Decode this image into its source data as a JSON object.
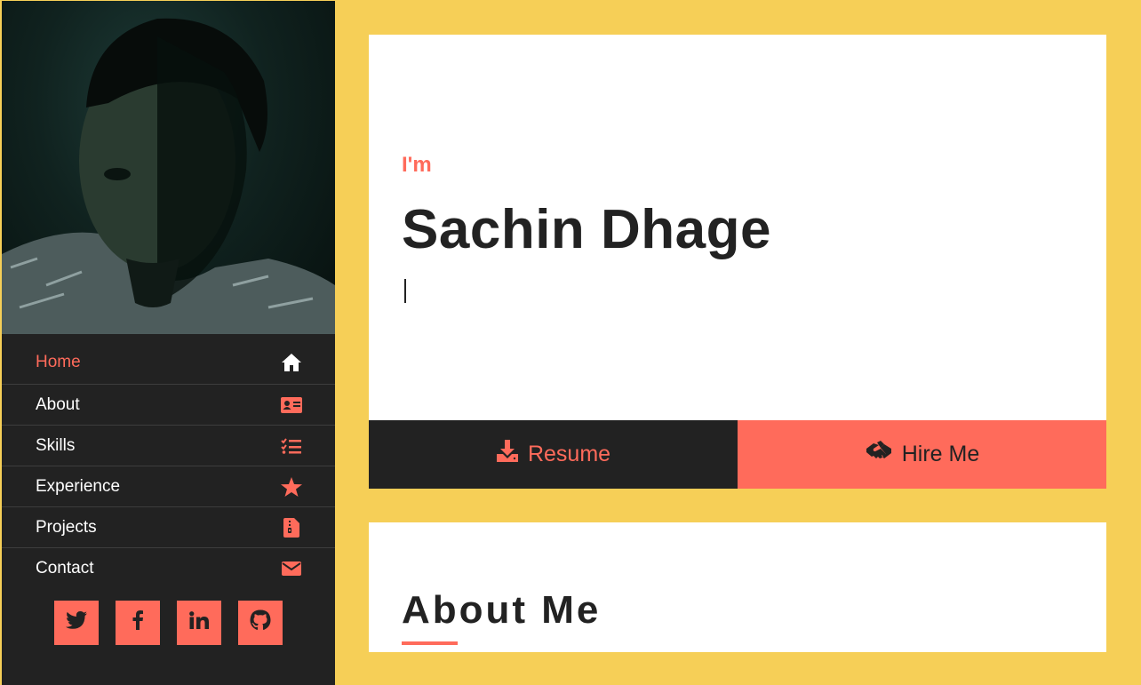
{
  "colors": {
    "accent": "#ff6b5b",
    "dark": "#222222",
    "background": "#f6cf57",
    "card": "#ffffff"
  },
  "sidebar": {
    "photo_icon": "portrait-photo",
    "nav": [
      {
        "label": "Home",
        "icon": "home-icon",
        "active": true
      },
      {
        "label": "About",
        "icon": "id-card-icon",
        "active": false
      },
      {
        "label": "Skills",
        "icon": "checklist-icon",
        "active": false
      },
      {
        "label": "Experience",
        "icon": "star-icon",
        "active": false
      },
      {
        "label": "Projects",
        "icon": "file-zip-icon",
        "active": false
      },
      {
        "label": "Contact",
        "icon": "envelope-icon",
        "active": false
      }
    ],
    "socials": [
      {
        "icon": "twitter-icon",
        "glyph": "🐦"
      },
      {
        "icon": "facebook-icon",
        "glyph": "f"
      },
      {
        "icon": "linkedin-icon",
        "glyph": "in"
      },
      {
        "icon": "github-icon",
        "glyph": ""
      }
    ]
  },
  "hero": {
    "intro": "I'm",
    "name": "Sachin Dhage",
    "resume_label": "Resume",
    "hire_label": "Hire Me"
  },
  "about": {
    "title": "About Me"
  }
}
